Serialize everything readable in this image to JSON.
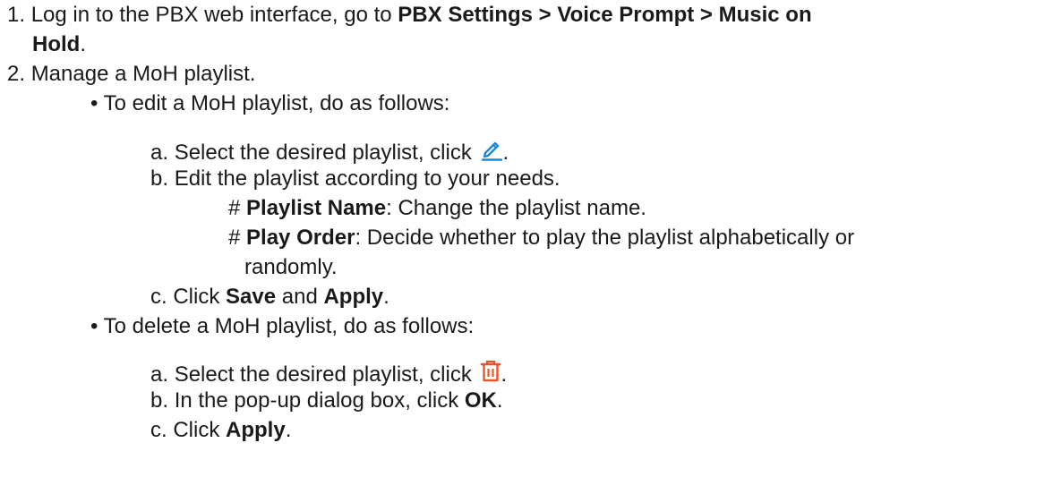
{
  "doc": {
    "step1": {
      "num": "1.",
      "text": "Log in to the PBX web interface, go to",
      "path": "PBX Settings > Voice Prompt > Music on",
      "path_cont": "Hold",
      "end": "."
    },
    "step2": {
      "num": "2.",
      "text": "Manage a MoH playlist."
    },
    "edit": {
      "bullet": "•",
      "intro": "To edit a MoH playlist, do as follows:",
      "a_label": "a.",
      "a_text": "Select the desired playlist, click",
      "a_end": ".",
      "b_label": "b.",
      "b_text": "Edit the playlist according to your needs.",
      "opt1_hash": "#",
      "opt1_term": "Playlist Name",
      "opt1_text": ": Change the playlist name.",
      "opt2_hash": "#",
      "opt2_term": "Play Order",
      "opt2_text": ": Decide whether to play the playlist alphabetically or",
      "opt2_cont": "randomly.",
      "c_label": "c.",
      "c_pre": "Click",
      "c_b1": "Save",
      "c_mid": "and",
      "c_b2": "Apply",
      "c_end": "."
    },
    "delete": {
      "bullet": "•",
      "intro": "To delete a MoH playlist, do as follows:",
      "a_label": "a.",
      "a_text": "Select the desired playlist, click",
      "a_end": ".",
      "b_label": "b.",
      "b_text": "In the pop-up dialog box, click",
      "b_bold": "OK",
      "b_end": ".",
      "c_label": "c.",
      "c_pre": "Click",
      "c_bold": "Apply",
      "c_end": "."
    },
    "icons": {
      "edit": "pencil-edit-icon",
      "edit_color": "#1e88d8",
      "delete": "trash-delete-icon",
      "delete_color": "#e4572e"
    }
  }
}
